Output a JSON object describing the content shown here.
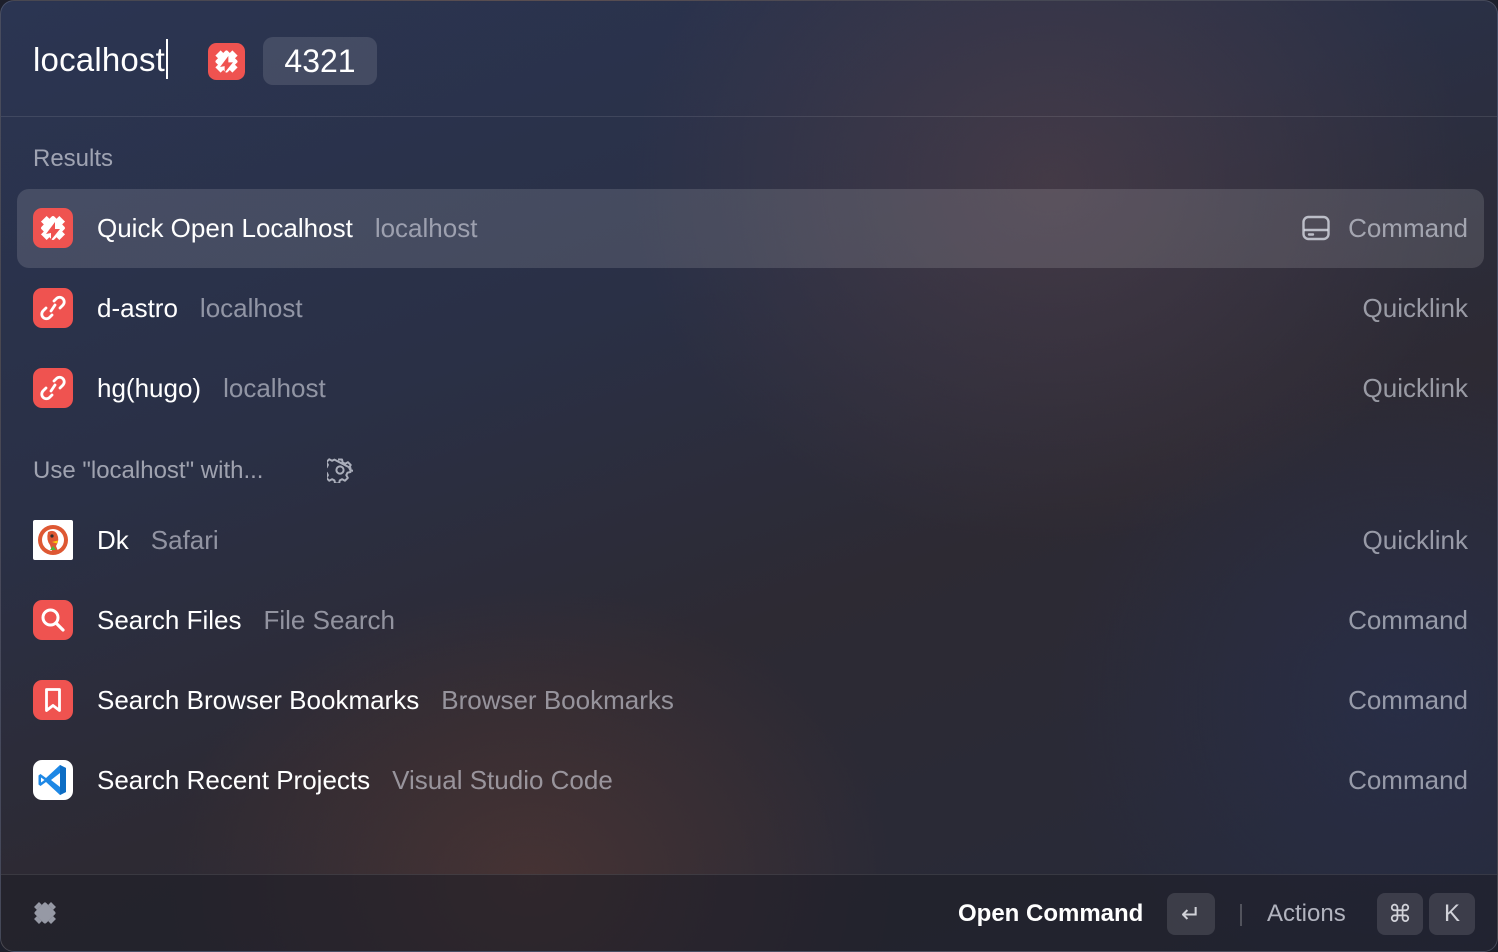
{
  "search": {
    "query": "localhost",
    "argument_icon": "raycast-localhost-icon",
    "argument_value": "4321"
  },
  "sections": {
    "results_label": "Results",
    "fallback_label": "Use \"localhost\" with...",
    "fallback_settings_icon": "gear-icon"
  },
  "results": [
    {
      "icon": "quick-open-localhost-icon",
      "title": "Quick Open Localhost",
      "subtitle": "localhost",
      "type": "Command",
      "type_icon": "hard-drive-icon"
    },
    {
      "icon": "link-icon",
      "title": "d-astro",
      "subtitle": "localhost",
      "type": "Quicklink"
    },
    {
      "icon": "link-icon",
      "title": "hg(hugo)",
      "subtitle": "localhost",
      "type": "Quicklink"
    }
  ],
  "fallbacks": [
    {
      "icon": "duckduckgo-icon",
      "title": "Dk",
      "subtitle": "Safari",
      "type": "Quicklink"
    },
    {
      "icon": "magnifying-glass-icon",
      "title": "Search Files",
      "subtitle": "File Search",
      "type": "Command"
    },
    {
      "icon": "bookmark-icon",
      "title": "Search Browser Bookmarks",
      "subtitle": "Browser Bookmarks",
      "type": "Command"
    },
    {
      "icon": "vscode-icon",
      "title": "Search Recent Projects",
      "subtitle": "Visual Studio Code",
      "type": "Command"
    }
  ],
  "footer": {
    "logo_icon": "raycast-logo-icon",
    "primary_action": "Open Command",
    "primary_key": "↵",
    "actions_label": "Actions",
    "actions_key_1": "⌘",
    "actions_key_2": "K"
  },
  "colors": {
    "accent_red": "#ef5350",
    "selected_row": "rgba(255,255,255,0.13)",
    "vscode_blue": "#1e88e5"
  }
}
